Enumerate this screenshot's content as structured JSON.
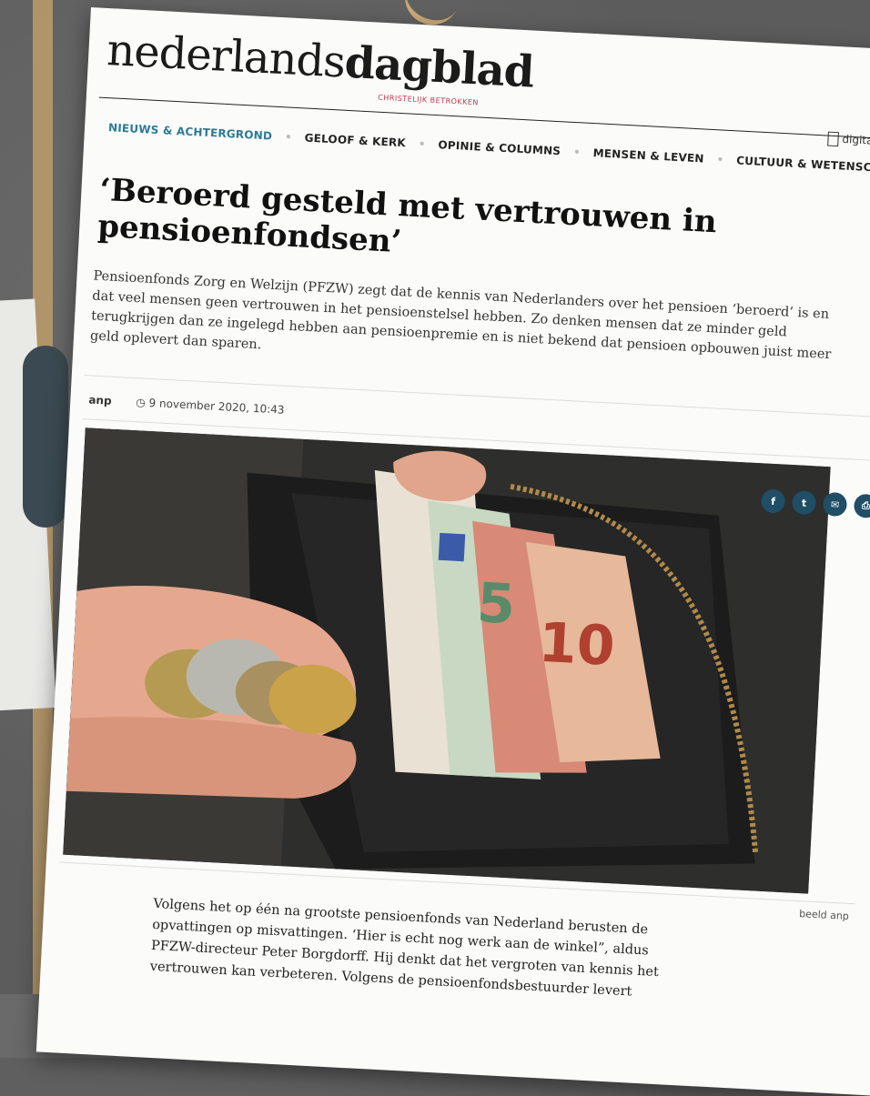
{
  "site": {
    "logo_light": "nederlands",
    "logo_bold": "dagblad",
    "tagline": "CHRISTELIJK BETROKKEN",
    "digital_label": "digitale krant"
  },
  "nav": {
    "items": [
      {
        "label": "NIEUWS & ACHTERGROND",
        "active": true
      },
      {
        "label": "GELOOF & KERK",
        "active": false
      },
      {
        "label": "OPINIE & COLUMNS",
        "active": false
      },
      {
        "label": "MENSEN & LEVEN",
        "active": false
      },
      {
        "label": "CULTUUR & WETENSCHAP",
        "active": false
      }
    ]
  },
  "article": {
    "headline": "‘Beroerd gesteld met vertrouwen in pensioenfondsen’",
    "lead": "Pensioenfonds Zorg en Welzijn (PFZW) zegt dat de kennis van Nederlanders over het pensioen ‘beroerd’ is en dat veel mensen geen vertrouwen in het pensioenstelsel hebben. Zo denken mensen dat ze minder geld terugkrijgen dan ze ingelegd hebben aan pensioenpremie en is niet bekend dat pensioen opbouwen juist meer geld oplevert dan sparen.",
    "byline": "anp",
    "date": "9 november 2020, 10:43",
    "image_credit": "beeld anp",
    "body": "Volgens het op één na grootste pensioenfonds van Nederland berusten de opvattingen op misvattingen. ‘Hier is echt nog werk aan de winkel”, aldus PFZW-directeur Peter Borgdorff. Hij denkt dat het vergroten van kennis het vertrouwen kan verbeteren. Volgens de pensioenfondsbestuurder levert"
  },
  "share": {
    "facebook": "f",
    "twitter": "t",
    "email": "✉",
    "print": "⎙"
  },
  "colors": {
    "accent": "#2b7a97",
    "share_bg": "#1f4e66",
    "tagline": "#c0354d"
  }
}
